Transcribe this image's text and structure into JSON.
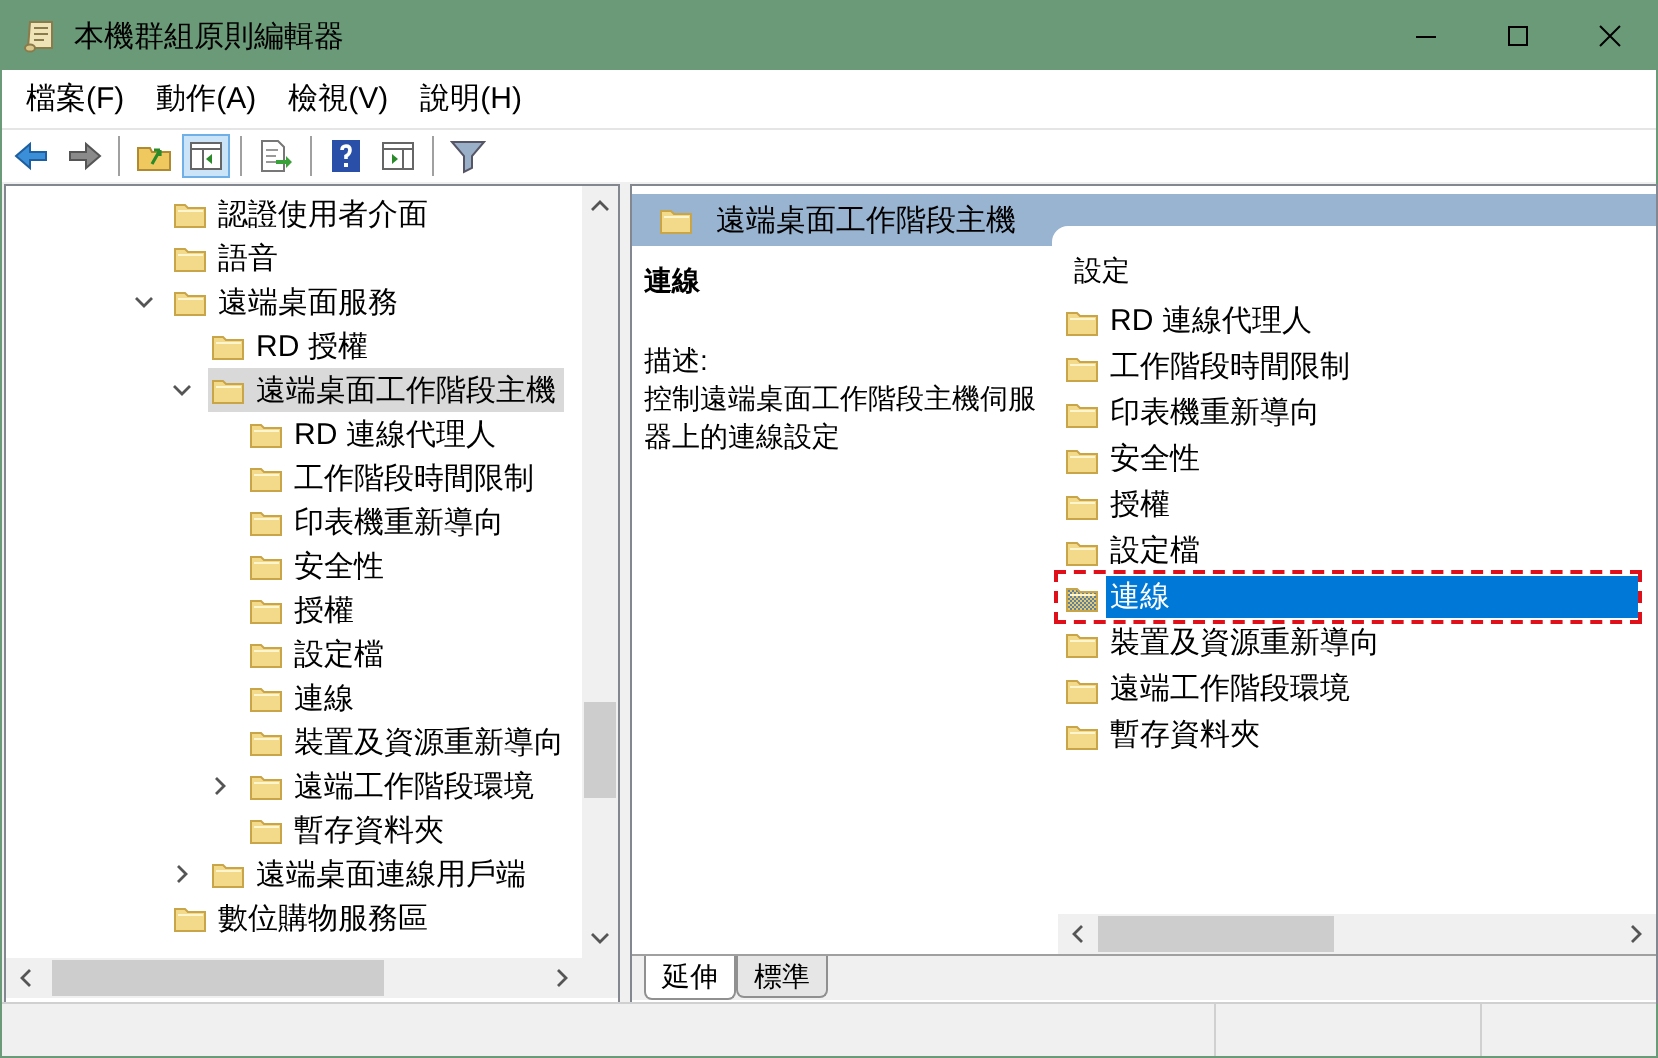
{
  "window": {
    "title": "本機群組原則編輯器"
  },
  "menu": [
    "檔案(F)",
    "動作(A)",
    "檢視(V)",
    "說明(H)"
  ],
  "toolbar": [
    [
      {
        "kind": "back",
        "pressed": false
      },
      {
        "kind": "forward",
        "pressed": false
      }
    ],
    [
      {
        "kind": "up",
        "pressed": false
      },
      {
        "kind": "tree_pane",
        "pressed": true
      }
    ],
    [
      {
        "kind": "export",
        "pressed": false
      }
    ],
    [
      {
        "kind": "help",
        "pressed": false
      },
      {
        "kind": "action_pane",
        "pressed": false
      }
    ],
    [
      {
        "kind": "filter",
        "pressed": false
      }
    ]
  ],
  "tree": {
    "items": [
      {
        "label": "認證使用者介面",
        "expandable": false,
        "selected": false
      },
      {
        "label": "語音",
        "expandable": false,
        "selected": false
      },
      {
        "label": "遠端桌面服務",
        "expandable": true,
        "expanded": true,
        "selected": false,
        "children": [
          {
            "label": "RD 授權",
            "expandable": false,
            "selected": false
          },
          {
            "label": "遠端桌面工作階段主機",
            "expandable": true,
            "expanded": true,
            "selected": true,
            "children": [
              {
                "label": "RD 連線代理人",
                "expandable": false,
                "selected": false
              },
              {
                "label": "工作階段時間限制",
                "expandable": false,
                "selected": false
              },
              {
                "label": "印表機重新導向",
                "expandable": false,
                "selected": false
              },
              {
                "label": "安全性",
                "expandable": false,
                "selected": false
              },
              {
                "label": "授權",
                "expandable": false,
                "selected": false
              },
              {
                "label": "設定檔",
                "expandable": false,
                "selected": false
              },
              {
                "label": "連線",
                "expandable": false,
                "selected": false
              },
              {
                "label": "裝置及資源重新導向",
                "expandable": false,
                "selected": false
              },
              {
                "label": "遠端工作階段環境",
                "expandable": true,
                "expanded": false,
                "selected": false
              },
              {
                "label": "暫存資料夾",
                "expandable": false,
                "selected": false
              }
            ]
          },
          {
            "label": "遠端桌面連線用戶端",
            "expandable": true,
            "expanded": false,
            "selected": false
          }
        ]
      },
      {
        "label": "數位購物服務區",
        "expandable": false,
        "selected": false
      }
    ]
  },
  "details": {
    "header": "遠端桌面工作階段主機",
    "name": "連線",
    "description_label": "描述:",
    "description": "控制遠端桌面工作階段主機伺服器上的連線設定",
    "list_header": "設定",
    "items": [
      {
        "label": "RD 連線代理人",
        "selected": false,
        "outlined": false
      },
      {
        "label": "工作階段時間限制",
        "selected": false,
        "outlined": false
      },
      {
        "label": "印表機重新導向",
        "selected": false,
        "outlined": false
      },
      {
        "label": "安全性",
        "selected": false,
        "outlined": false
      },
      {
        "label": "授權",
        "selected": false,
        "outlined": false
      },
      {
        "label": "設定檔",
        "selected": false,
        "outlined": false
      },
      {
        "label": "連線",
        "selected": true,
        "outlined": true
      },
      {
        "label": "裝置及資源重新導向",
        "selected": false,
        "outlined": false
      },
      {
        "label": "遠端工作階段環境",
        "selected": false,
        "outlined": false
      },
      {
        "label": "暫存資料夾",
        "selected": false,
        "outlined": false
      }
    ]
  },
  "view_tabs": [
    {
      "label": "延伸",
      "selected": true
    },
    {
      "label": "標準",
      "selected": false
    }
  ]
}
